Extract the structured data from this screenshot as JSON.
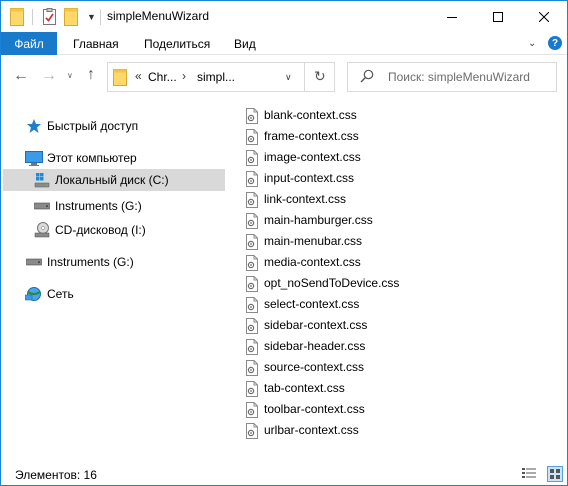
{
  "window": {
    "title": "simpleMenuWizard",
    "accent": "#1979ca"
  },
  "titlebar": {
    "minimize_icon": "minimize-icon",
    "maximize_icon": "maximize-icon",
    "close_icon": "close-icon"
  },
  "ribbon": {
    "file_tab": "Файл",
    "tabs": [
      {
        "label": "Главная"
      },
      {
        "label": "Поделиться"
      },
      {
        "label": "Вид"
      }
    ],
    "help_label": "?"
  },
  "navigation": {
    "address_overflow": "«",
    "path": [
      "Chr...",
      "simpl..."
    ],
    "search_placeholder": "Поиск: simpleMenuWizard"
  },
  "sidebar": {
    "items": [
      {
        "label": "Быстрый доступ",
        "icon": "star-icon"
      },
      {
        "label": "Этот компьютер",
        "icon": "computer-icon"
      },
      {
        "label": "Локальный диск (C:)",
        "icon": "windows-drive-icon",
        "selected": true
      },
      {
        "label": "Instruments (G:)",
        "icon": "drive-icon"
      },
      {
        "label": "CD-дисковод (I:)",
        "icon": "cd-drive-icon"
      },
      {
        "label": "Instruments (G:)",
        "icon": "drive-icon"
      },
      {
        "label": "Сеть",
        "icon": "network-icon"
      }
    ]
  },
  "files": [
    {
      "name": "blank-context.css"
    },
    {
      "name": "frame-context.css"
    },
    {
      "name": "image-context.css"
    },
    {
      "name": "input-context.css"
    },
    {
      "name": "link-context.css"
    },
    {
      "name": "main-hamburger.css"
    },
    {
      "name": "main-menubar.css"
    },
    {
      "name": "media-context.css"
    },
    {
      "name": "opt_noSendToDevice.css"
    },
    {
      "name": "select-context.css"
    },
    {
      "name": "sidebar-context.css"
    },
    {
      "name": "sidebar-header.css"
    },
    {
      "name": "source-context.css"
    },
    {
      "name": "tab-context.css"
    },
    {
      "name": "toolbar-context.css"
    },
    {
      "name": "urlbar-context.css"
    }
  ],
  "status": {
    "item_count": "Элементов: 16"
  }
}
